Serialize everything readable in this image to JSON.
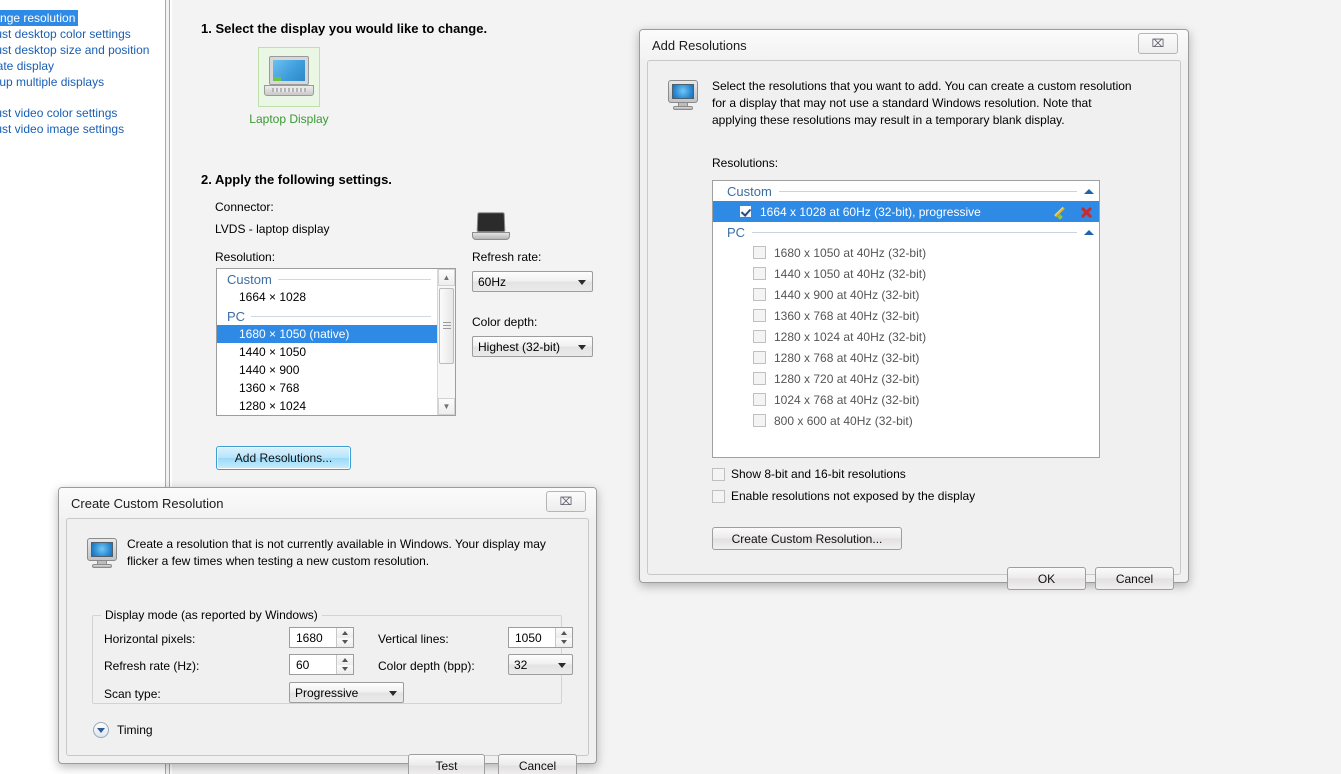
{
  "sidebar": {
    "items": [
      {
        "label": "Change resolution",
        "selected": true
      },
      {
        "label": "Adjust desktop color settings",
        "selected": false
      },
      {
        "label": "Adjust desktop size and position",
        "selected": false
      },
      {
        "label": "Rotate display",
        "selected": false
      },
      {
        "label": "Set up multiple displays",
        "selected": false
      },
      {
        "label": "Adjust video color settings",
        "selected": false
      },
      {
        "label": "Adjust video image settings",
        "selected": false
      }
    ]
  },
  "main": {
    "step1_title": "1. Select the display you would like to change.",
    "display_label": "Laptop Display",
    "step2_title": "2. Apply the following settings.",
    "connector_label": "Connector:",
    "connector_value": "LVDS - laptop display",
    "resolution_label": "Resolution:",
    "resolution_groups": [
      {
        "name": "Custom",
        "items": [
          {
            "label": "1664 × 1028",
            "selected": false
          }
        ]
      },
      {
        "name": "PC",
        "items": [
          {
            "label": "1680 × 1050 (native)",
            "selected": true
          },
          {
            "label": "1440 × 1050",
            "selected": false
          },
          {
            "label": "1440 × 900",
            "selected": false
          },
          {
            "label": "1360 × 768",
            "selected": false
          },
          {
            "label": "1280 × 1024",
            "selected": false
          }
        ]
      }
    ],
    "refresh_rate_label": "Refresh rate:",
    "refresh_rate_value": "60Hz",
    "color_depth_label": "Color depth:",
    "color_depth_value": "Highest (32-bit)",
    "add_resolutions_button": "Add Resolutions..."
  },
  "add_resolutions_dialog": {
    "title": "Add Resolutions",
    "close_glyph": "⌧",
    "description": "Select the resolutions that you want to add. You can create a custom resolution for a display that may not use a standard Windows resolution. Note that applying these resolutions may result in a temporary blank display.",
    "resolutions_label": "Resolutions:",
    "groups": [
      {
        "name": "Custom",
        "items": [
          {
            "label": "1664 x 1028 at 60Hz (32-bit), progressive",
            "checked": true,
            "selected": true,
            "has_edit": true,
            "has_delete": true
          }
        ]
      },
      {
        "name": "PC",
        "items": [
          {
            "label": "1680 x 1050 at 40Hz (32-bit)",
            "checked": false,
            "selected": false
          },
          {
            "label": "1440 x 1050 at 40Hz (32-bit)",
            "checked": false,
            "selected": false
          },
          {
            "label": "1440 x 900 at 40Hz (32-bit)",
            "checked": false,
            "selected": false
          },
          {
            "label": "1360 x 768 at 40Hz (32-bit)",
            "checked": false,
            "selected": false
          },
          {
            "label": "1280 x 1024 at 40Hz (32-bit)",
            "checked": false,
            "selected": false
          },
          {
            "label": "1280 x 768 at 40Hz (32-bit)",
            "checked": false,
            "selected": false
          },
          {
            "label": "1280 x 720 at 40Hz (32-bit)",
            "checked": false,
            "selected": false
          },
          {
            "label": "1024 x 768 at 40Hz (32-bit)",
            "checked": false,
            "selected": false
          },
          {
            "label": "800 x 600 at 40Hz (32-bit)",
            "checked": false,
            "selected": false
          }
        ]
      }
    ],
    "checkbox_8_16bit": "Show 8-bit and 16-bit resolutions",
    "checkbox_not_exposed": "Enable resolutions not exposed by the display",
    "create_custom_button": "Create Custom Resolution...",
    "ok_button": "OK",
    "cancel_button": "Cancel"
  },
  "create_custom_dialog": {
    "title": "Create Custom Resolution",
    "close_glyph": "⌧",
    "description": "Create a resolution that is not currently available in Windows. Your display may flicker a few times when testing a new custom resolution.",
    "group_title": "Display mode (as reported by Windows)",
    "horizontal_pixels_label": "Horizontal pixels:",
    "horizontal_pixels_value": "1680",
    "vertical_lines_label": "Vertical lines:",
    "vertical_lines_value": "1050",
    "refresh_rate_label": "Refresh rate (Hz):",
    "refresh_rate_value": "60",
    "color_depth_label": "Color depth (bpp):",
    "color_depth_value": "32",
    "scan_type_label": "Scan type:",
    "scan_type_value": "Progressive",
    "timing_label": "Timing",
    "test_button": "Test",
    "cancel_button": "Cancel"
  },
  "colors": {
    "accent_selection": "#2f8ae5",
    "link": "#1a5fb4",
    "group_header": "#3b6ea5",
    "display_label": "#3a9a32",
    "delete_red": "#cc2a2a"
  }
}
